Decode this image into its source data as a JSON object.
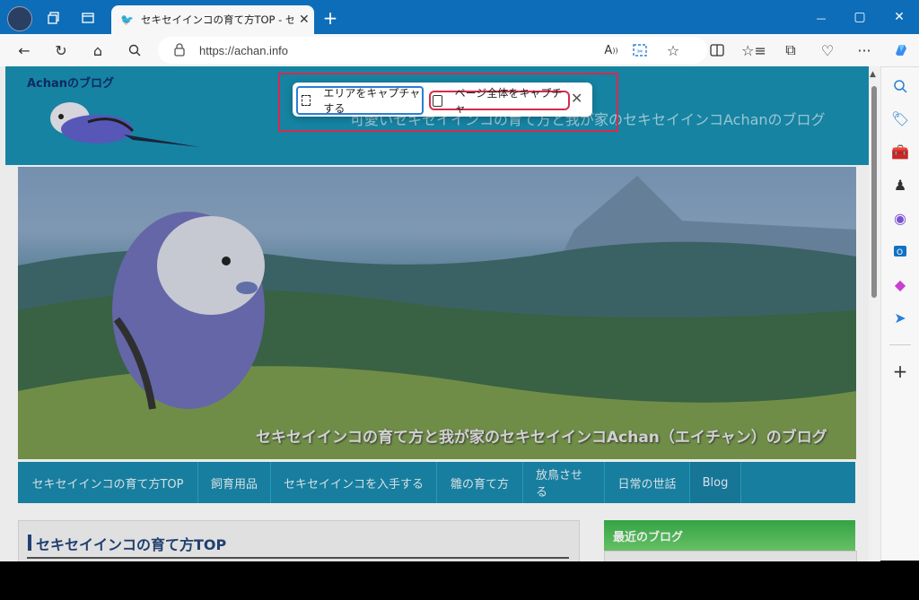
{
  "tab": {
    "title": "セキセイインコの育て方TOP - セキセイ",
    "close": "✕",
    "new_tab": "+"
  },
  "window": {
    "minimize": "—",
    "maximize": "▢",
    "close": "✕"
  },
  "address": {
    "url": "https://achan.info"
  },
  "site": {
    "blog_name": "Achanのブログ",
    "tagline": "可愛いセキセイインコの育て方と我が家のセキセイインコAchanのブログ",
    "hero_caption": "セキセイインコの育て方と我が家のセキセイインコAchan（エイチャン）のブログ",
    "nav": [
      "セキセイインコの育て方TOP",
      "飼育用品",
      "セキセイインコを入手する",
      "雛の育て方",
      "放鳥させる",
      "日常の世話",
      "Blog"
    ],
    "content_title": "セキセイインコの育て方TOP",
    "recent_title": "最近のブログ"
  },
  "capture": {
    "area_label": "エリアをキャプチャする",
    "page_label": "ページ全体をキャプチャ"
  },
  "colors": {
    "titlebar": "#0d6db8",
    "header": "#188fb0",
    "nav": "#1989ad",
    "accent_red": "#d62a4d",
    "accent_blue": "#2a7fd4"
  }
}
